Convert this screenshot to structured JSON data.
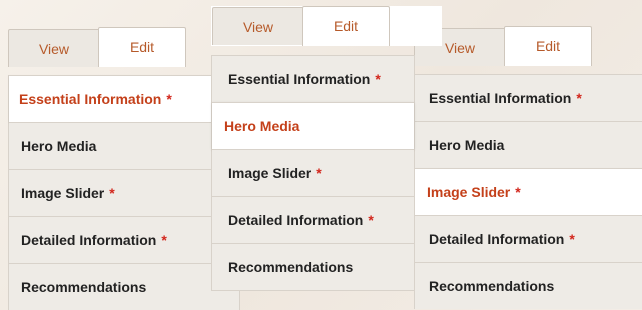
{
  "tabs": {
    "view": "View",
    "edit": "Edit"
  },
  "required_marker": "*",
  "panels": [
    {
      "active_item": "Essential Information",
      "items": [
        {
          "label": "Essential Information",
          "required": true
        },
        {
          "label": "Hero Media",
          "required": false
        },
        {
          "label": "Image Slider",
          "required": true
        },
        {
          "label": "Detailed Information",
          "required": true
        },
        {
          "label": "Recommendations",
          "required": false
        }
      ]
    },
    {
      "active_item": "Hero Media",
      "items": [
        {
          "label": "Essential Information",
          "required": true
        },
        {
          "label": "Hero Media",
          "required": false
        },
        {
          "label": "Image Slider",
          "required": true
        },
        {
          "label": "Detailed Information",
          "required": true
        },
        {
          "label": "Recommendations",
          "required": false
        }
      ]
    },
    {
      "active_item": "Image Slider",
      "items": [
        {
          "label": "Essential Information",
          "required": true
        },
        {
          "label": "Hero Media",
          "required": false
        },
        {
          "label": "Image Slider",
          "required": true
        },
        {
          "label": "Detailed Information",
          "required": true
        },
        {
          "label": "Recommendations",
          "required": false
        }
      ]
    }
  ],
  "colors": {
    "active_text": "#c4401a",
    "required_star": "#d2261c",
    "tab_text": "#b65a2a"
  }
}
